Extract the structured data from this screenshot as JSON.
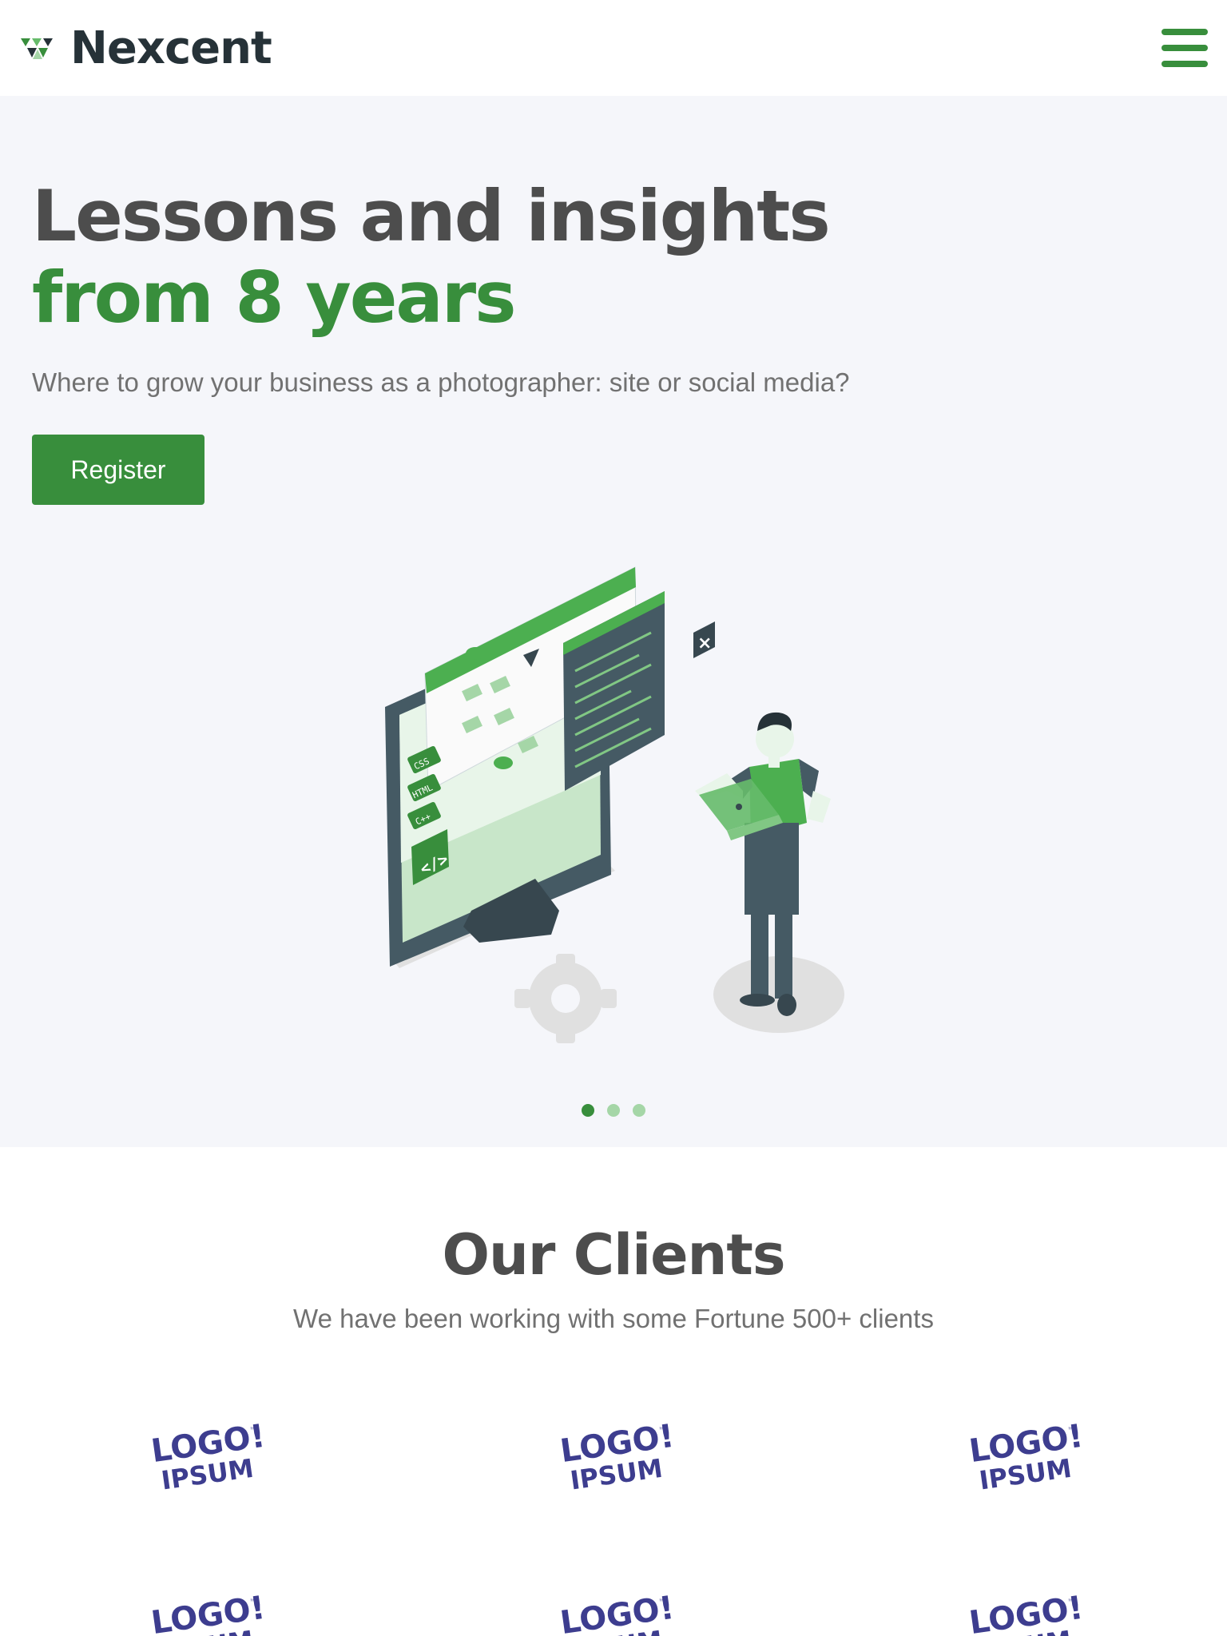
{
  "header": {
    "brand_name": "Nexcent",
    "menu_icon": "hamburger-menu-icon",
    "colors": {
      "brand": "#263238",
      "accent": "#388e3c"
    }
  },
  "hero": {
    "title_line1": "Lessons and insights",
    "title_line2": "from 8 years",
    "subtitle": "Where to grow your business as a photographer: site or social media?",
    "register_label": "Register",
    "illustration_tags": [
      "CSS",
      "HTML",
      "C++"
    ],
    "carousel": {
      "slide_count": 3,
      "active_index": 0
    }
  },
  "clients": {
    "title": "Our Clients",
    "subtitle": "We have been working with some Fortune 500+ clients",
    "logo_text_top": "LOGO!",
    "logo_text_bottom": "IPSUM",
    "logo_tm": "™",
    "logo_color": "#3d3d8f"
  }
}
